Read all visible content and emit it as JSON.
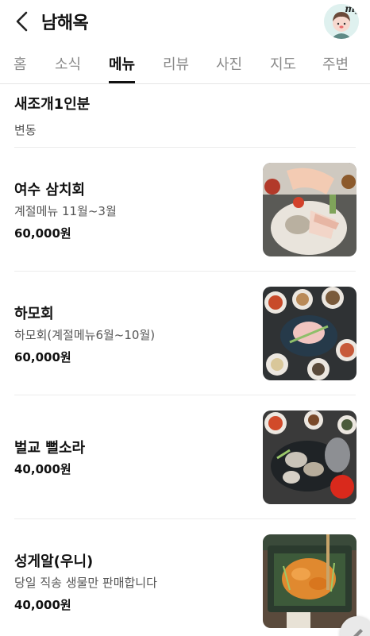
{
  "header": {
    "title": "남해옥",
    "avatar_label": "my"
  },
  "tabs": [
    "홈",
    "소식",
    "메뉴",
    "리뷰",
    "사진",
    "지도",
    "주변"
  ],
  "active_tab": "메뉴",
  "menu": [
    {
      "name": "새조개1인분",
      "desc": "변동",
      "price": ""
    },
    {
      "name": "여수 삼치회",
      "desc": "계절메뉴 11월~3월",
      "price": "60,000원"
    },
    {
      "name": "하모회",
      "desc": "하모회(계절메뉴6월~10월)",
      "price": "60,000원"
    },
    {
      "name": "벌교 뻘소라",
      "desc": "",
      "price": "40,000원"
    },
    {
      "name": "성게알(우니)",
      "desc": "당일 직송 생물만 판매합니다",
      "price": "40,000원"
    }
  ],
  "icons": {
    "back": "chevron-left-icon",
    "fab": "pencil-icon"
  },
  "colors": {
    "text": "#111111",
    "muted": "#8a8a8a",
    "divider": "#ececec",
    "active_underline": "#111111"
  }
}
